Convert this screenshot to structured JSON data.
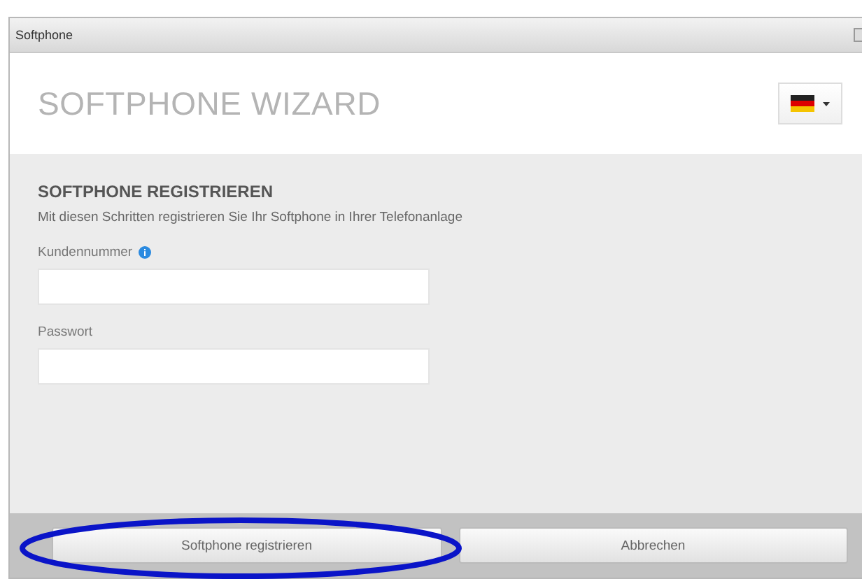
{
  "window": {
    "title": "Softphone"
  },
  "header": {
    "title": "SOFTPHONE WIZARD"
  },
  "section": {
    "title": "SOFTPHONE REGISTRIEREN",
    "description": "Mit diesen Schritten registrieren Sie Ihr Softphone in Ihrer Telefonanlage"
  },
  "fields": [
    {
      "label": "Kundennummer",
      "info": true
    },
    {
      "label": "Passwort",
      "info": false
    }
  ],
  "buttons": [
    {
      "label": "Softphone registrieren",
      "highlighted": true
    },
    {
      "label": "Abbrechen",
      "highlighted": false
    }
  ]
}
